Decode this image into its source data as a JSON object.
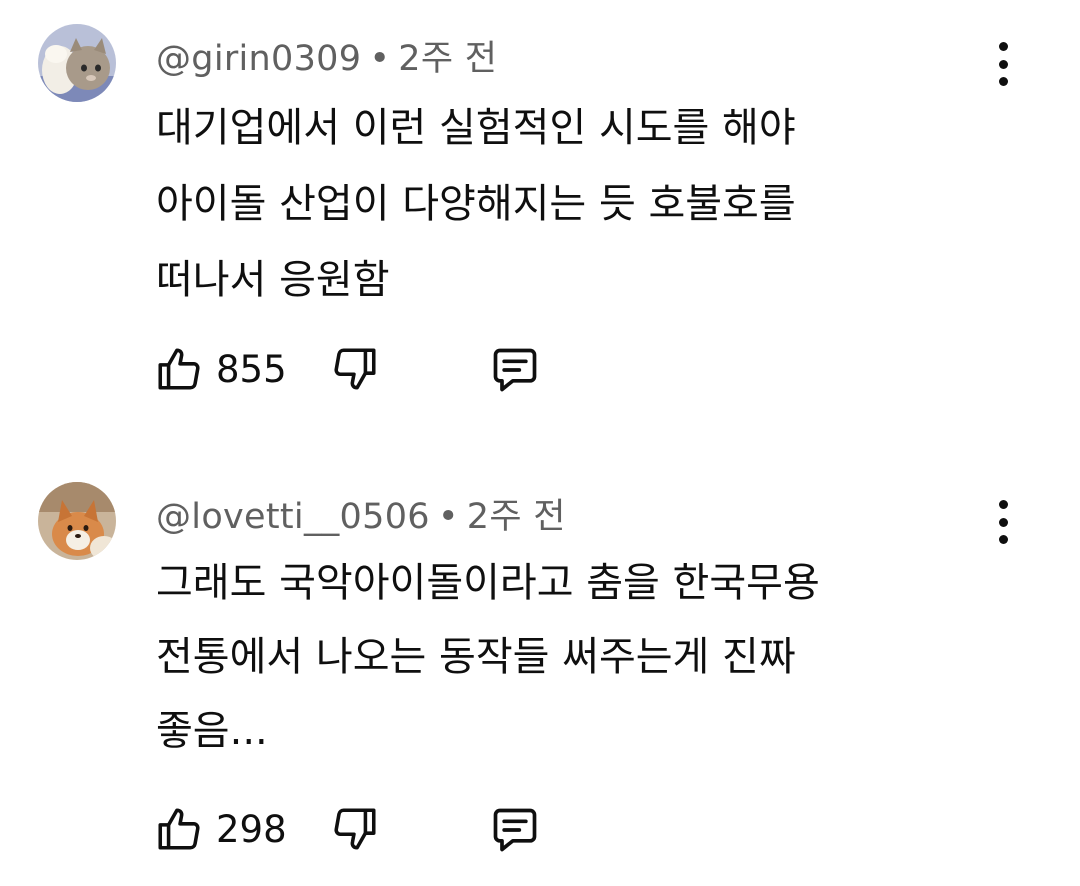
{
  "comments": [
    {
      "author": "@girin0309",
      "separator": "•",
      "time": "2주 전",
      "text": "대기업에서 이런 실험적인 시도를 해야\n아이돌 산업이 다양해지는 듯 호불호를\n떠나서 응원함",
      "likes": "855",
      "avatar_icon": "cat-avatar-icon"
    },
    {
      "author": "@lovetti__0506",
      "separator": "•",
      "time": "2주 전",
      "text": "그래도 국악아이돌이라고 춤을 한국무용\n전통에서 나오는 동작들 써주는게 진짜\n좋음...",
      "likes": "298",
      "avatar_icon": "fox-avatar-icon"
    }
  ],
  "icons": {
    "like": "thumbs-up-icon",
    "dislike": "thumbs-down-icon",
    "reply": "reply-comment-icon",
    "more": "more-vertical-icon"
  },
  "colors": {
    "text": "#0f0f0f",
    "meta": "#606060",
    "background": "#ffffff"
  }
}
